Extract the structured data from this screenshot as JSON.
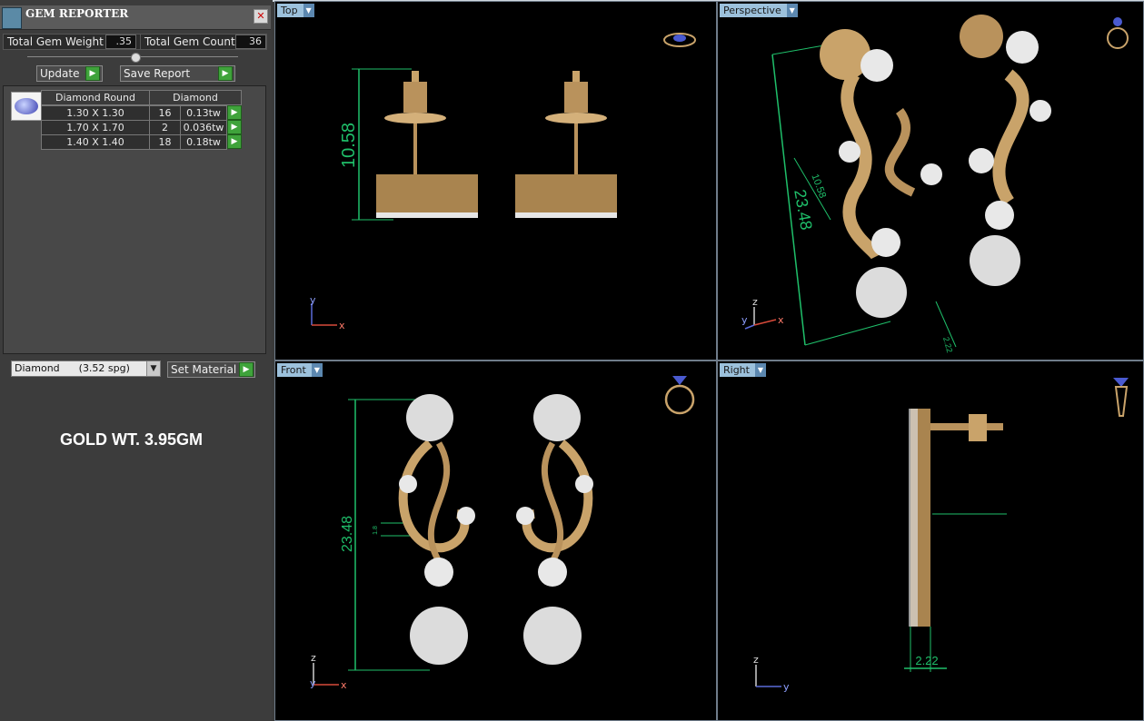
{
  "panel": {
    "title": "GEM REPORTER",
    "close_icon": "close-icon",
    "total_gem_weight_label": "Total Gem Weight",
    "total_gem_weight_value": ".35",
    "total_gem_count_label": "Total Gem Count",
    "total_gem_count_value": "36",
    "update_label": "Update",
    "save_report_label": "Save Report",
    "table": {
      "headers": [
        "Diamond Round",
        "Diamond"
      ],
      "rows": [
        {
          "size": "1.30 X 1.30",
          "count": "16",
          "weight": "0.13tw"
        },
        {
          "size": "1.70 X 1.70",
          "count": "2",
          "weight": "0.036tw"
        },
        {
          "size": "1.40 X 1.40",
          "count": "18",
          "weight": "0.18tw"
        }
      ]
    },
    "material_select": "Diamond      (3.52 spg)",
    "set_material_label": "Set Material",
    "gold_weight_text": "GOLD WT. 3.95GM"
  },
  "views": {
    "top": {
      "label": "Top",
      "dimension": "10.58",
      "axis_a": "y",
      "axis_b": "x"
    },
    "perspective": {
      "label": "Perspective",
      "dim_long": "23.48",
      "dim_short": "10.58",
      "dim_tiny": "2.22",
      "axis_a": "z",
      "axis_b": "y",
      "axis_c": "x"
    },
    "front": {
      "label": "Front",
      "dimension": "23.48",
      "dim_small": "1.8",
      "axis_a": "z",
      "axis_b": "y",
      "axis_c": "x"
    },
    "right": {
      "label": "Right",
      "dimension": "2.22",
      "axis_a": "z",
      "axis_b": "y"
    }
  },
  "colors": {
    "gold": "#c9a36a",
    "dimension_green": "#1fbf6a",
    "view_label_bg": "#9cc1dc"
  }
}
